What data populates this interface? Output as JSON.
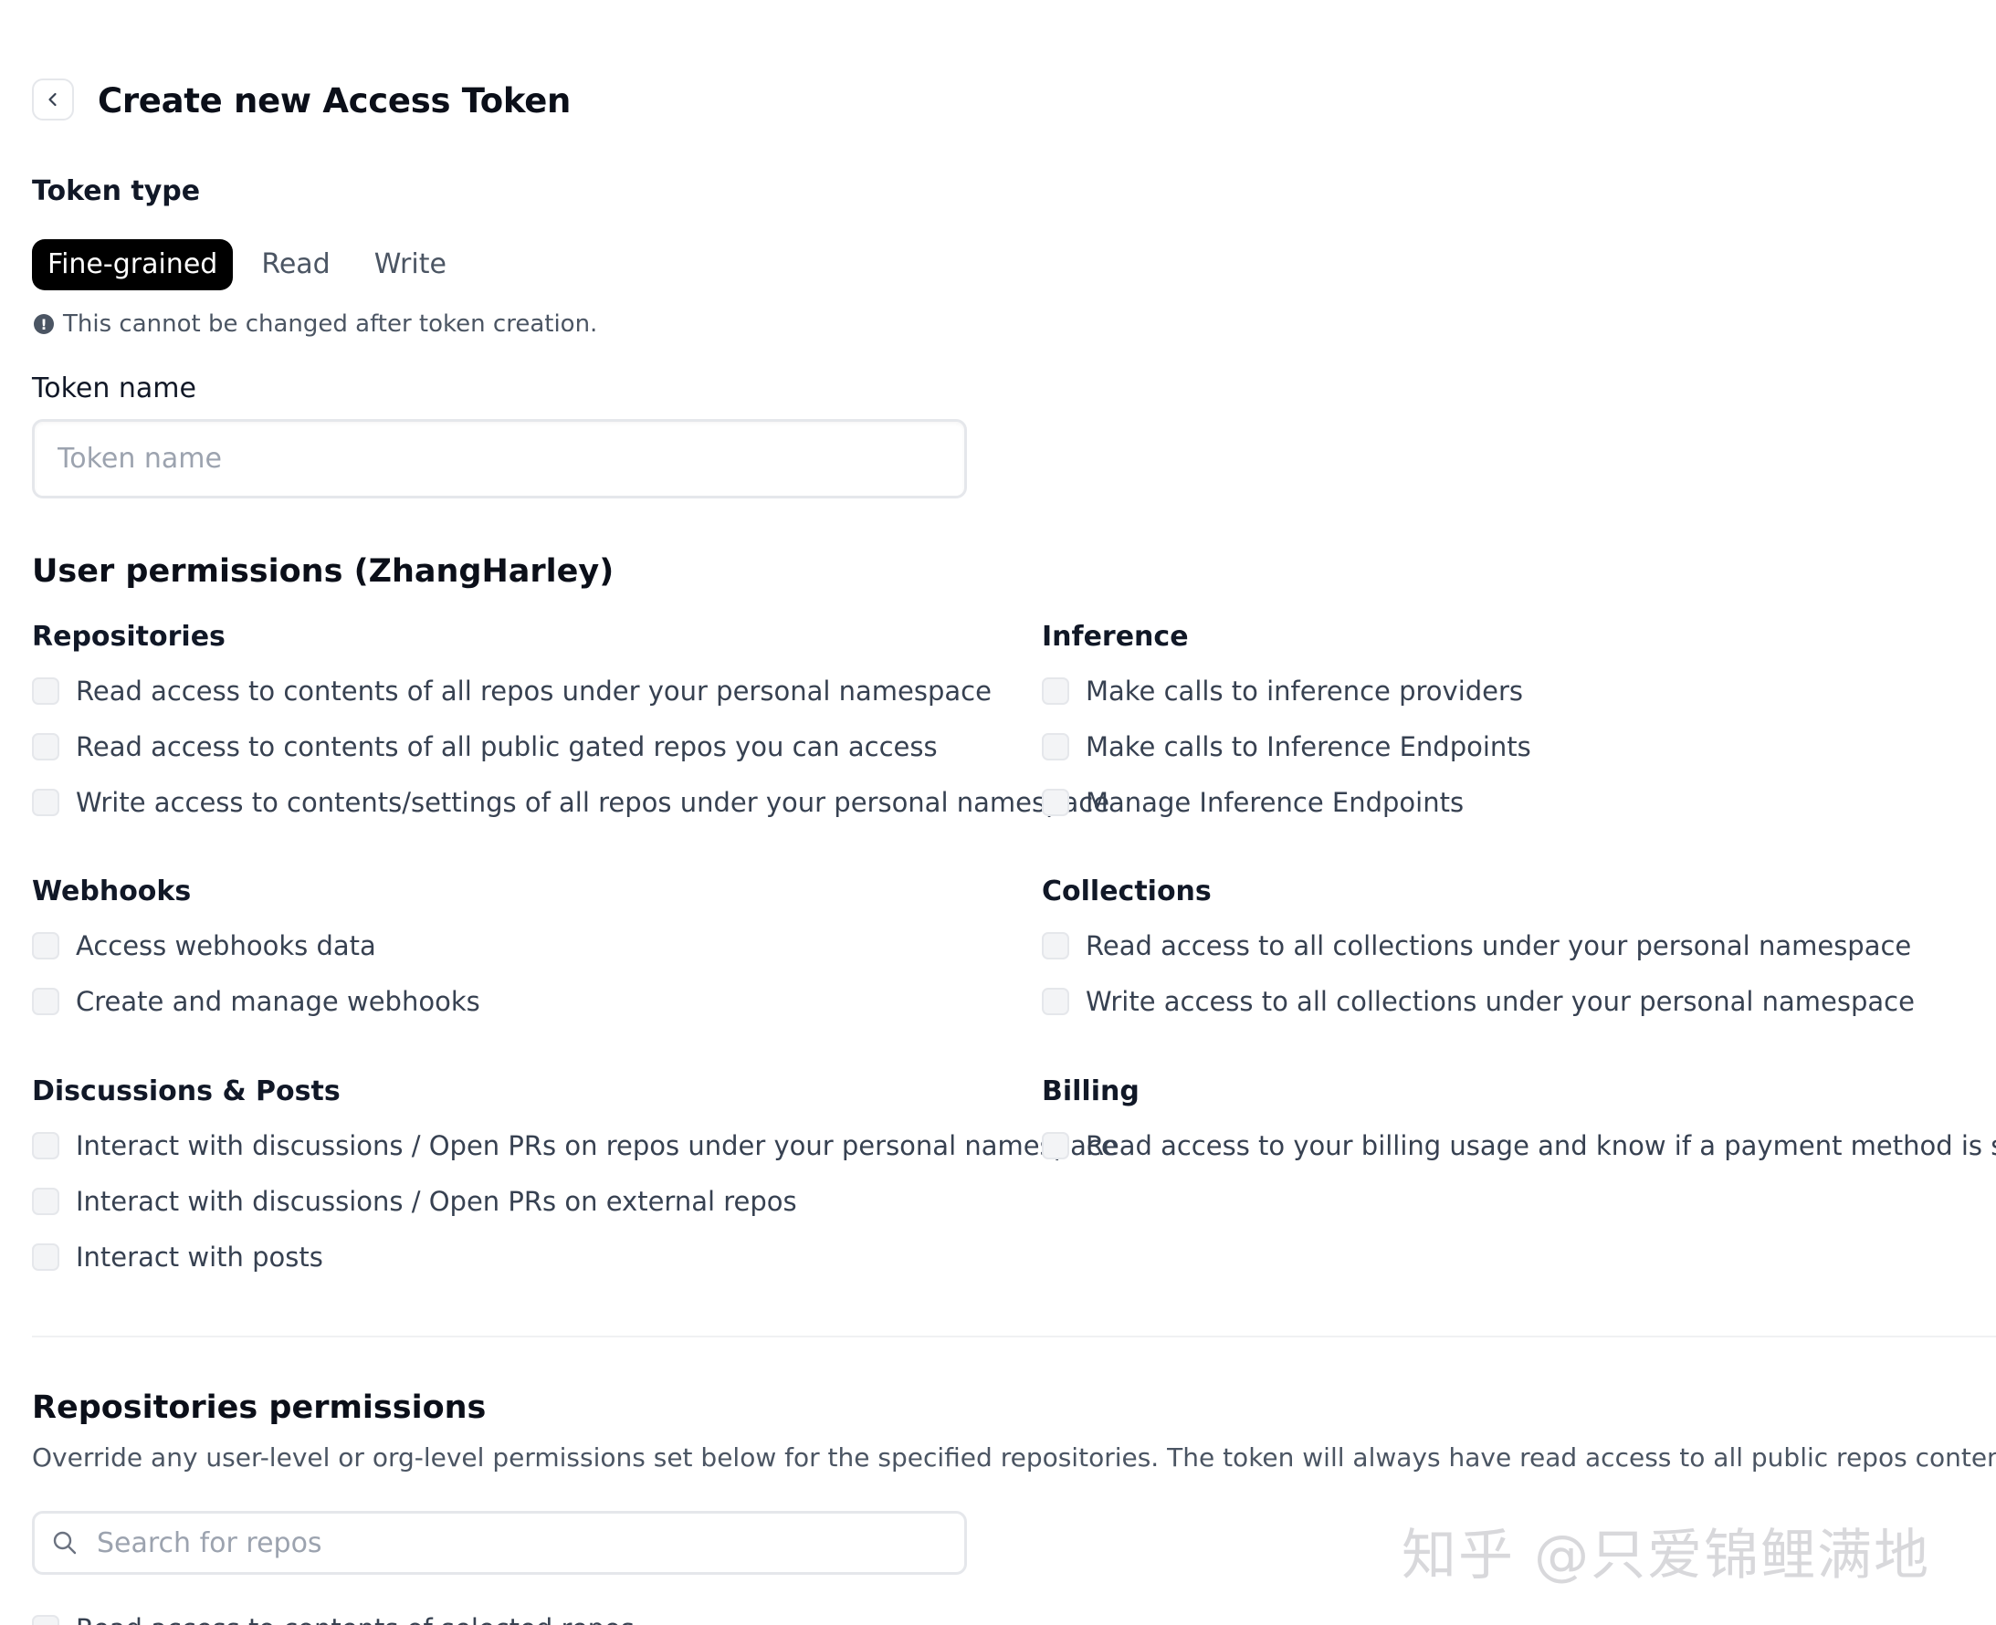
{
  "header": {
    "back_icon": "chevron-left-icon",
    "title": "Create new Access Token"
  },
  "token_type": {
    "label": "Token type",
    "options": [
      "Fine-grained",
      "Read",
      "Write"
    ],
    "selected": "Fine-grained",
    "notice_icon": "exclamation-circle-icon",
    "notice": "This cannot be changed after token creation."
  },
  "token_name": {
    "label": "Token name",
    "placeholder": "Token name",
    "value": ""
  },
  "user_permissions": {
    "title": "User permissions (ZhangHarley)",
    "repositories": {
      "title": "Repositories",
      "items": [
        "Read access to contents of all repos under your personal namespace",
        "Read access to contents of all public gated repos you can access",
        "Write access to contents/settings of all repos under your personal namespace"
      ]
    },
    "inference": {
      "title": "Inference",
      "items": [
        "Make calls to inference providers",
        "Make calls to Inference Endpoints",
        "Manage Inference Endpoints"
      ]
    },
    "webhooks": {
      "title": "Webhooks",
      "items": [
        "Access webhooks data",
        "Create and manage webhooks"
      ]
    },
    "collections": {
      "title": "Collections",
      "items": [
        "Read access to all collections under your personal namespace",
        "Write access to all collections under your personal namespace"
      ]
    },
    "discussions": {
      "title": "Discussions & Posts",
      "items": [
        "Interact with discussions / Open PRs on repos under your personal namespace",
        "Interact with discussions / Open PRs on external repos",
        "Interact with posts"
      ]
    },
    "billing": {
      "title": "Billing",
      "items": [
        "Read access to your billing usage and know if a payment method is set"
      ]
    }
  },
  "repositories_permissions": {
    "title": "Repositories permissions",
    "description": "Override any user-level or org-level permissions set below for the specified repositories. The token will always have read access to all public repos contents.",
    "search_placeholder": "Search for repos",
    "search_icon": "search-icon",
    "partial_item": "Read access to contents of selected repos"
  },
  "watermark": "知乎 @只爱锦鲤满地",
  "colors": {
    "active_segment_bg": "#000000",
    "checkbox_bg": "#f3f4f6",
    "border": "#e5e7eb",
    "muted_text": "#4b5563"
  }
}
